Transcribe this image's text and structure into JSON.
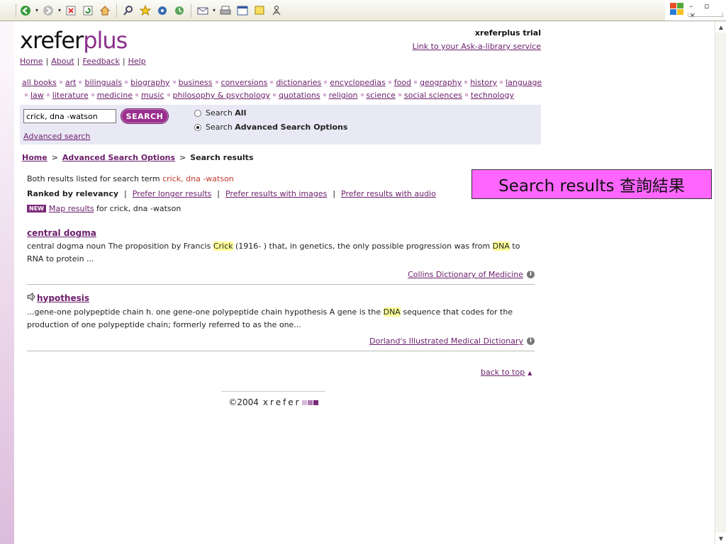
{
  "toolbar": {
    "icons": [
      "back-icon",
      "forward-icon",
      "stop-icon",
      "refresh-icon",
      "home-icon",
      "search-icon",
      "favorites-icon",
      "media-icon",
      "history-icon",
      "mail-icon",
      "print-icon",
      "edit-icon",
      "discuss-icon",
      "messenger-icon"
    ],
    "window_controls": "– ▫ ×"
  },
  "header": {
    "logo_main": "xrefer",
    "logo_plus": "plus",
    "trial": "xreferplus trial",
    "ask_library": "Link to your Ask-a-library service"
  },
  "topnav": {
    "home": "Home",
    "about": "About",
    "feedback": "Feedback",
    "help": "Help"
  },
  "categories": [
    "all books",
    "art",
    "bilinguals",
    "biography",
    "business",
    "conversions",
    "dictionaries",
    "encyclopedias",
    "food",
    "geography",
    "history",
    "language",
    "law",
    "literature",
    "medicine",
    "music",
    "philosophy & psychology",
    "quotations",
    "religion",
    "science",
    "social sciences",
    "technology"
  ],
  "search": {
    "value": "crick, dna -watson",
    "button": "SEARCH",
    "radio_all": "Search All",
    "radio_all_bold": "All",
    "radio_adv": "Search Advanced Search Options",
    "radio_adv_prefix": "Search ",
    "radio_adv_bold": "Advanced Search Options",
    "radio_all_prefix": "Search ",
    "advanced_link": "Advanced search"
  },
  "breadcrumb": {
    "home": "Home",
    "advanced": "Advanced Search Options",
    "current": "Search results",
    "sep": ">"
  },
  "results_info": {
    "prefix": "Both results listed for search term",
    "term": "crick, dna -watson",
    "ranked": "Ranked by relevancy",
    "prefer_longer": "Prefer longer results",
    "prefer_images": "Prefer results with images",
    "prefer_audio": "Prefer results with audio",
    "new_badge": "NEW",
    "map_link": "Map results",
    "map_suffix": "for crick, dna -watson"
  },
  "results": [
    {
      "title": "central dogma",
      "text_a": "central dogma noun The proposition by Francis ",
      "hl_1": "Crick",
      "text_b": " (1916- ) that, in genetics, the only possible progression was from ",
      "hl_2": "DNA",
      "text_c": " to RNA to protein ...",
      "source": "Collins Dictionary of Medicine"
    },
    {
      "title": "hypothesis",
      "text_a": "...gene-one polypeptide chain h. one gene-one polypeptide chain hypothesis A gene is the ",
      "hl_1": "DNA",
      "text_b": " sequence that codes for the production of one polypeptide chain; formerly referred to as the one...",
      "source": "Dorland's Illustrated Medical Dictionary"
    }
  ],
  "back_to_top": "back to top",
  "footer": {
    "copyright": "©2004",
    "brand": "xrefer"
  },
  "annotation": "Search results 查詢結果",
  "colors": {
    "accent": "#6b1e6b",
    "button": "#9a2e8e",
    "search_bg": "#e9e9f5",
    "annotation_bg": "#ff66ff",
    "highlight": "#ffff99"
  }
}
